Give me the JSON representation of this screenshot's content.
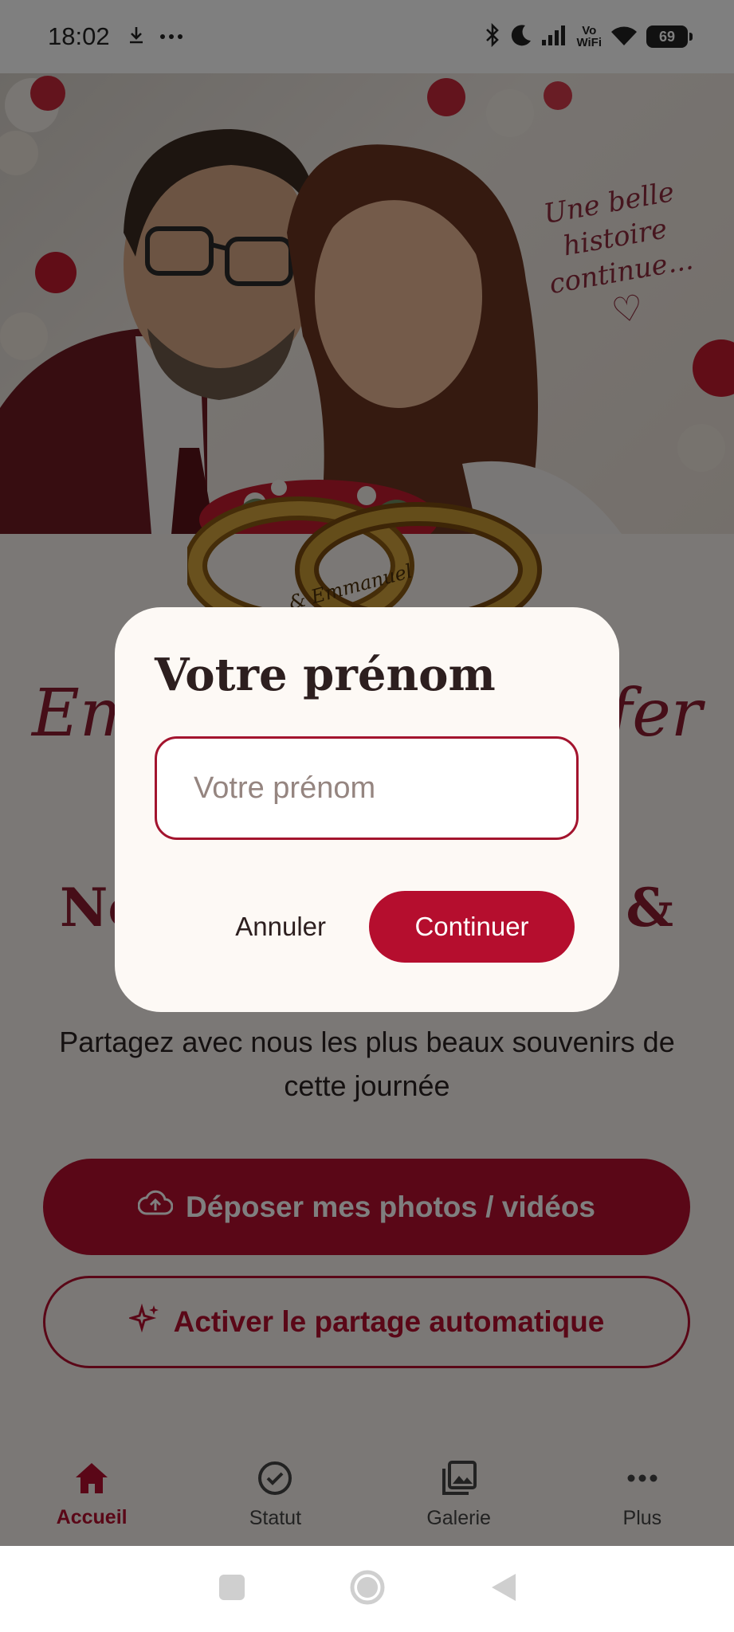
{
  "status_bar": {
    "time": "18:02",
    "battery": "69",
    "vowifi_top": "Vo",
    "vowifi_bottom": "WiFi",
    "icons": [
      "download-icon",
      "more-dots-icon",
      "bluetooth-icon",
      "moon-icon",
      "signal-icon",
      "vowifi-icon",
      "wifi-icon",
      "battery-icon"
    ]
  },
  "hero": {
    "script_line1": "Une belle",
    "script_line2": "histoire",
    "script_line3": "continue...",
    "heart": "♡",
    "ring_engraving": "& Emmanuel"
  },
  "page": {
    "names_left": "Em",
    "names_right": "fer",
    "subtitle_left": "No",
    "subtitle_right": "&",
    "tagline": "Partagez avec nous les plus beaux souvenirs de cette journée",
    "upload_button": "Déposer mes photos / vidéos",
    "auto_share_button": "Activer le partage automatique"
  },
  "bottom_nav": {
    "items": [
      {
        "label": "Accueil",
        "icon": "home-icon",
        "active": true
      },
      {
        "label": "Statut",
        "icon": "check-circle-icon",
        "active": false
      },
      {
        "label": "Galerie",
        "icon": "gallery-icon",
        "active": false
      },
      {
        "label": "Plus",
        "icon": "more-dots-icon",
        "active": false
      }
    ]
  },
  "dialog": {
    "title": "Votre prénom",
    "input_placeholder": "Votre prénom",
    "input_value": "",
    "cancel_label": "Annuler",
    "continue_label": "Continuer"
  },
  "colors": {
    "accent": "#b50e2e",
    "title_red": "#8c1d31",
    "dialog_bg": "#fdf9f5"
  }
}
